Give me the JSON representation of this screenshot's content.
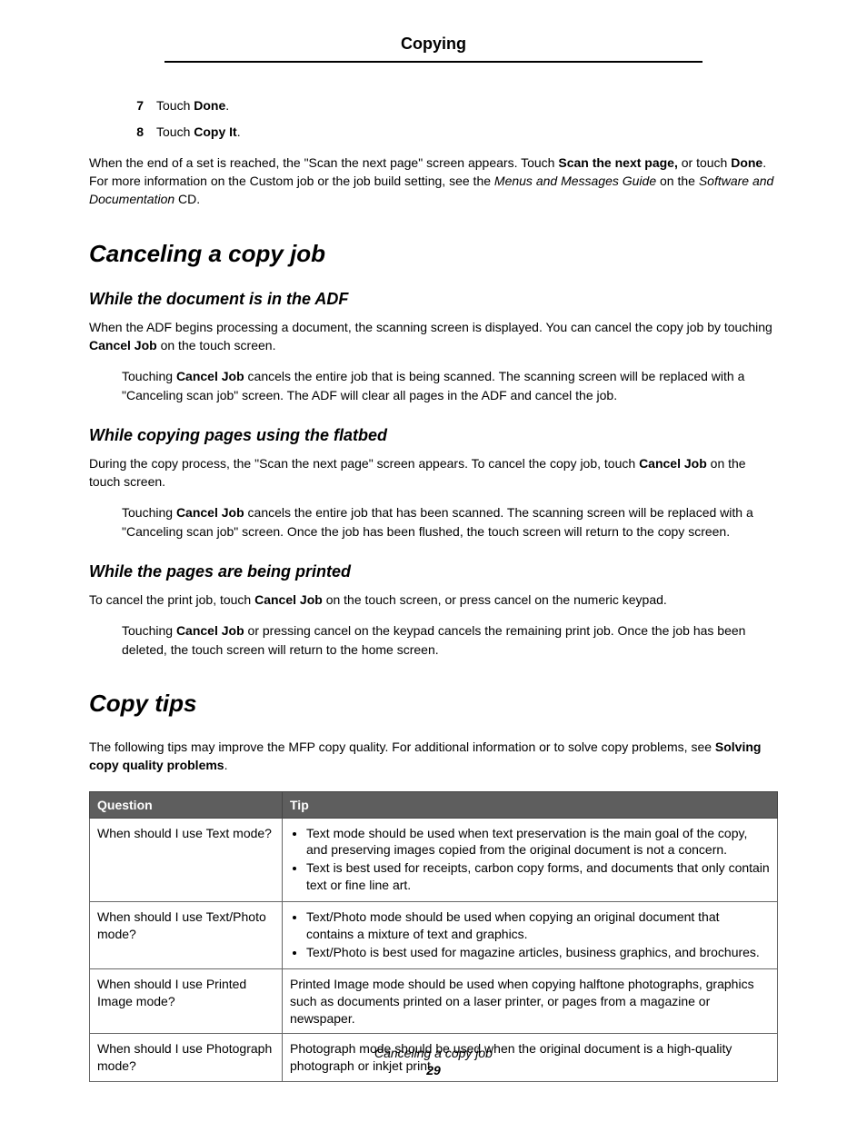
{
  "header": {
    "title": "Copying"
  },
  "steps": [
    {
      "num": "7",
      "prefix": "Touch ",
      "bold": "Done",
      "suffix": "."
    },
    {
      "num": "8",
      "prefix": "Touch ",
      "bold": "Copy It",
      "suffix": "."
    }
  ],
  "intro_para": {
    "t1": "When the end of a set is reached, the \"Scan the next page\" screen appears. Touch ",
    "b1": "Scan the next page,",
    "t2": " or touch ",
    "b2": "Done",
    "t3": ". For more information on the Custom job or the job build setting, see the ",
    "i1": "Menus and Messages Guide",
    "t4": " on the ",
    "i2": "Software and Documentation",
    "t5": " CD."
  },
  "h_cancel": "Canceling a copy job",
  "sec_adf": {
    "heading": "While the document is in the ADF",
    "p1a": "When the ADF begins processing a document, the scanning screen is displayed. You can cancel the copy job by touching ",
    "p1b": "Cancel Job",
    "p1c": " on the touch screen.",
    "p2a": "Touching ",
    "p2b": "Cancel Job",
    "p2c": " cancels the entire job that is being scanned. The scanning screen will be replaced with a \"Canceling scan job\" screen. The ADF will clear all pages in the ADF and cancel the job."
  },
  "sec_flatbed": {
    "heading": "While copying pages using the flatbed",
    "p1a": "During the copy process, the \"Scan the next page\" screen appears. To cancel the copy job, touch ",
    "p1b": "Cancel Job",
    "p1c": " on the touch screen.",
    "p2a": "Touching ",
    "p2b": "Cancel Job",
    "p2c": " cancels the entire job that has been scanned. The scanning screen will be replaced with a \"Canceling scan job\" screen. Once the job has been flushed, the touch screen will return to the copy screen."
  },
  "sec_printed": {
    "heading": "While the pages are being printed",
    "p1a": "To cancel the print job, touch ",
    "p1b": "Cancel Job",
    "p1c": " on the touch screen, or press cancel on the numeric keypad.",
    "p2a": "Touching ",
    "p2b": "Cancel Job",
    "p2c": " or pressing cancel on the keypad cancels the remaining print job. Once the job has been deleted, the touch screen will return to the home screen."
  },
  "h_tips": "Copy tips",
  "tips_intro": {
    "t1": "The following tips may improve the MFP copy quality. For additional information or to solve copy problems, see ",
    "b1": "Solving copy quality problems",
    "t2": "."
  },
  "table": {
    "headers": {
      "q": "Question",
      "t": "Tip"
    },
    "rows": [
      {
        "q": "When should I use Text mode?",
        "type": "list",
        "items": [
          "Text mode should be used when text preservation is the main goal of the copy, and preserving images copied from the original document is not a concern.",
          "Text is best used for receipts, carbon copy forms, and documents that only contain text or fine line art."
        ]
      },
      {
        "q": "When should I use Text/Photo mode?",
        "type": "list",
        "items": [
          "Text/Photo mode should be used when copying an original document that contains a mixture of text and graphics.",
          "Text/Photo is best used for magazine articles, business graphics, and brochures."
        ]
      },
      {
        "q": "When should I use Printed Image mode?",
        "type": "text",
        "text": "Printed Image mode should be used when copying halftone photographs, graphics such as documents printed on a laser printer, or pages from a magazine or newspaper."
      },
      {
        "q": "When should I use Photograph mode?",
        "type": "text",
        "text": "Photograph mode should be used when the original document is a high-quality photograph or inkjet print."
      }
    ]
  },
  "footer": {
    "title": "Canceling a copy job",
    "page": "29"
  }
}
